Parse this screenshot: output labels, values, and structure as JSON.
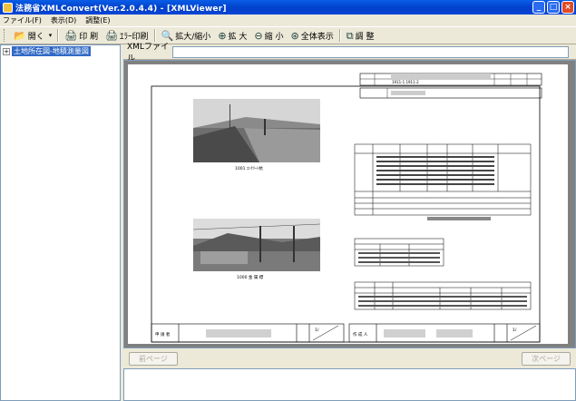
{
  "window": {
    "title": "法務省XMLConvert(Ver.2.0.4.4) - [XMLViewer]",
    "minimize": "_",
    "maximize": "□",
    "close": "×"
  },
  "menu": {
    "file": "ファイル(F)",
    "view": "表示(D)",
    "adjust": "調整(E)"
  },
  "toolbar": {
    "open": "開く",
    "print": "印 刷",
    "error_print": "ｴﾗｰ印刷",
    "zoom_fit": "拡大/縮小",
    "zoom_in": "拡 大",
    "zoom_out": "縮 小",
    "full_view": "全体表示",
    "adjust": "調 整"
  },
  "tree": {
    "item": "土地所在図-地積測量図"
  },
  "filebar": {
    "label": "XMLファイル"
  },
  "document": {
    "photo1_caption": "1001  ｺﾝｸﾘｰﾄ杭",
    "photo2_caption": "1000  金 属 標",
    "right_top_code": "1911-1 1911-2",
    "left_footer_label": "申 請 者",
    "right_footer_label": "作 成 人",
    "scale_1": "1/",
    "scale_2": "1/"
  },
  "nav": {
    "prev": "前ページ",
    "next": "次ページ"
  }
}
